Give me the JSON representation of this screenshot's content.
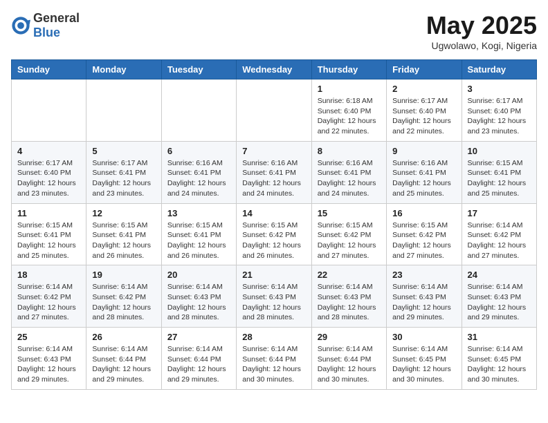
{
  "header": {
    "logo": {
      "general": "General",
      "blue": "Blue"
    },
    "title": "May 2025",
    "location": "Ugwolawo, Kogi, Nigeria"
  },
  "weekdays": [
    "Sunday",
    "Monday",
    "Tuesday",
    "Wednesday",
    "Thursday",
    "Friday",
    "Saturday"
  ],
  "weeks": [
    [
      {
        "day": "",
        "info": ""
      },
      {
        "day": "",
        "info": ""
      },
      {
        "day": "",
        "info": ""
      },
      {
        "day": "",
        "info": ""
      },
      {
        "day": "1",
        "info": "Sunrise: 6:18 AM\nSunset: 6:40 PM\nDaylight: 12 hours\nand 22 minutes."
      },
      {
        "day": "2",
        "info": "Sunrise: 6:17 AM\nSunset: 6:40 PM\nDaylight: 12 hours\nand 22 minutes."
      },
      {
        "day": "3",
        "info": "Sunrise: 6:17 AM\nSunset: 6:40 PM\nDaylight: 12 hours\nand 23 minutes."
      }
    ],
    [
      {
        "day": "4",
        "info": "Sunrise: 6:17 AM\nSunset: 6:40 PM\nDaylight: 12 hours\nand 23 minutes."
      },
      {
        "day": "5",
        "info": "Sunrise: 6:17 AM\nSunset: 6:41 PM\nDaylight: 12 hours\nand 23 minutes."
      },
      {
        "day": "6",
        "info": "Sunrise: 6:16 AM\nSunset: 6:41 PM\nDaylight: 12 hours\nand 24 minutes."
      },
      {
        "day": "7",
        "info": "Sunrise: 6:16 AM\nSunset: 6:41 PM\nDaylight: 12 hours\nand 24 minutes."
      },
      {
        "day": "8",
        "info": "Sunrise: 6:16 AM\nSunset: 6:41 PM\nDaylight: 12 hours\nand 24 minutes."
      },
      {
        "day": "9",
        "info": "Sunrise: 6:16 AM\nSunset: 6:41 PM\nDaylight: 12 hours\nand 25 minutes."
      },
      {
        "day": "10",
        "info": "Sunrise: 6:15 AM\nSunset: 6:41 PM\nDaylight: 12 hours\nand 25 minutes."
      }
    ],
    [
      {
        "day": "11",
        "info": "Sunrise: 6:15 AM\nSunset: 6:41 PM\nDaylight: 12 hours\nand 25 minutes."
      },
      {
        "day": "12",
        "info": "Sunrise: 6:15 AM\nSunset: 6:41 PM\nDaylight: 12 hours\nand 26 minutes."
      },
      {
        "day": "13",
        "info": "Sunrise: 6:15 AM\nSunset: 6:41 PM\nDaylight: 12 hours\nand 26 minutes."
      },
      {
        "day": "14",
        "info": "Sunrise: 6:15 AM\nSunset: 6:42 PM\nDaylight: 12 hours\nand 26 minutes."
      },
      {
        "day": "15",
        "info": "Sunrise: 6:15 AM\nSunset: 6:42 PM\nDaylight: 12 hours\nand 27 minutes."
      },
      {
        "day": "16",
        "info": "Sunrise: 6:15 AM\nSunset: 6:42 PM\nDaylight: 12 hours\nand 27 minutes."
      },
      {
        "day": "17",
        "info": "Sunrise: 6:14 AM\nSunset: 6:42 PM\nDaylight: 12 hours\nand 27 minutes."
      }
    ],
    [
      {
        "day": "18",
        "info": "Sunrise: 6:14 AM\nSunset: 6:42 PM\nDaylight: 12 hours\nand 27 minutes."
      },
      {
        "day": "19",
        "info": "Sunrise: 6:14 AM\nSunset: 6:42 PM\nDaylight: 12 hours\nand 28 minutes."
      },
      {
        "day": "20",
        "info": "Sunrise: 6:14 AM\nSunset: 6:43 PM\nDaylight: 12 hours\nand 28 minutes."
      },
      {
        "day": "21",
        "info": "Sunrise: 6:14 AM\nSunset: 6:43 PM\nDaylight: 12 hours\nand 28 minutes."
      },
      {
        "day": "22",
        "info": "Sunrise: 6:14 AM\nSunset: 6:43 PM\nDaylight: 12 hours\nand 28 minutes."
      },
      {
        "day": "23",
        "info": "Sunrise: 6:14 AM\nSunset: 6:43 PM\nDaylight: 12 hours\nand 29 minutes."
      },
      {
        "day": "24",
        "info": "Sunrise: 6:14 AM\nSunset: 6:43 PM\nDaylight: 12 hours\nand 29 minutes."
      }
    ],
    [
      {
        "day": "25",
        "info": "Sunrise: 6:14 AM\nSunset: 6:43 PM\nDaylight: 12 hours\nand 29 minutes."
      },
      {
        "day": "26",
        "info": "Sunrise: 6:14 AM\nSunset: 6:44 PM\nDaylight: 12 hours\nand 29 minutes."
      },
      {
        "day": "27",
        "info": "Sunrise: 6:14 AM\nSunset: 6:44 PM\nDaylight: 12 hours\nand 29 minutes."
      },
      {
        "day": "28",
        "info": "Sunrise: 6:14 AM\nSunset: 6:44 PM\nDaylight: 12 hours\nand 30 minutes."
      },
      {
        "day": "29",
        "info": "Sunrise: 6:14 AM\nSunset: 6:44 PM\nDaylight: 12 hours\nand 30 minutes."
      },
      {
        "day": "30",
        "info": "Sunrise: 6:14 AM\nSunset: 6:45 PM\nDaylight: 12 hours\nand 30 minutes."
      },
      {
        "day": "31",
        "info": "Sunrise: 6:14 AM\nSunset: 6:45 PM\nDaylight: 12 hours\nand 30 minutes."
      }
    ]
  ]
}
